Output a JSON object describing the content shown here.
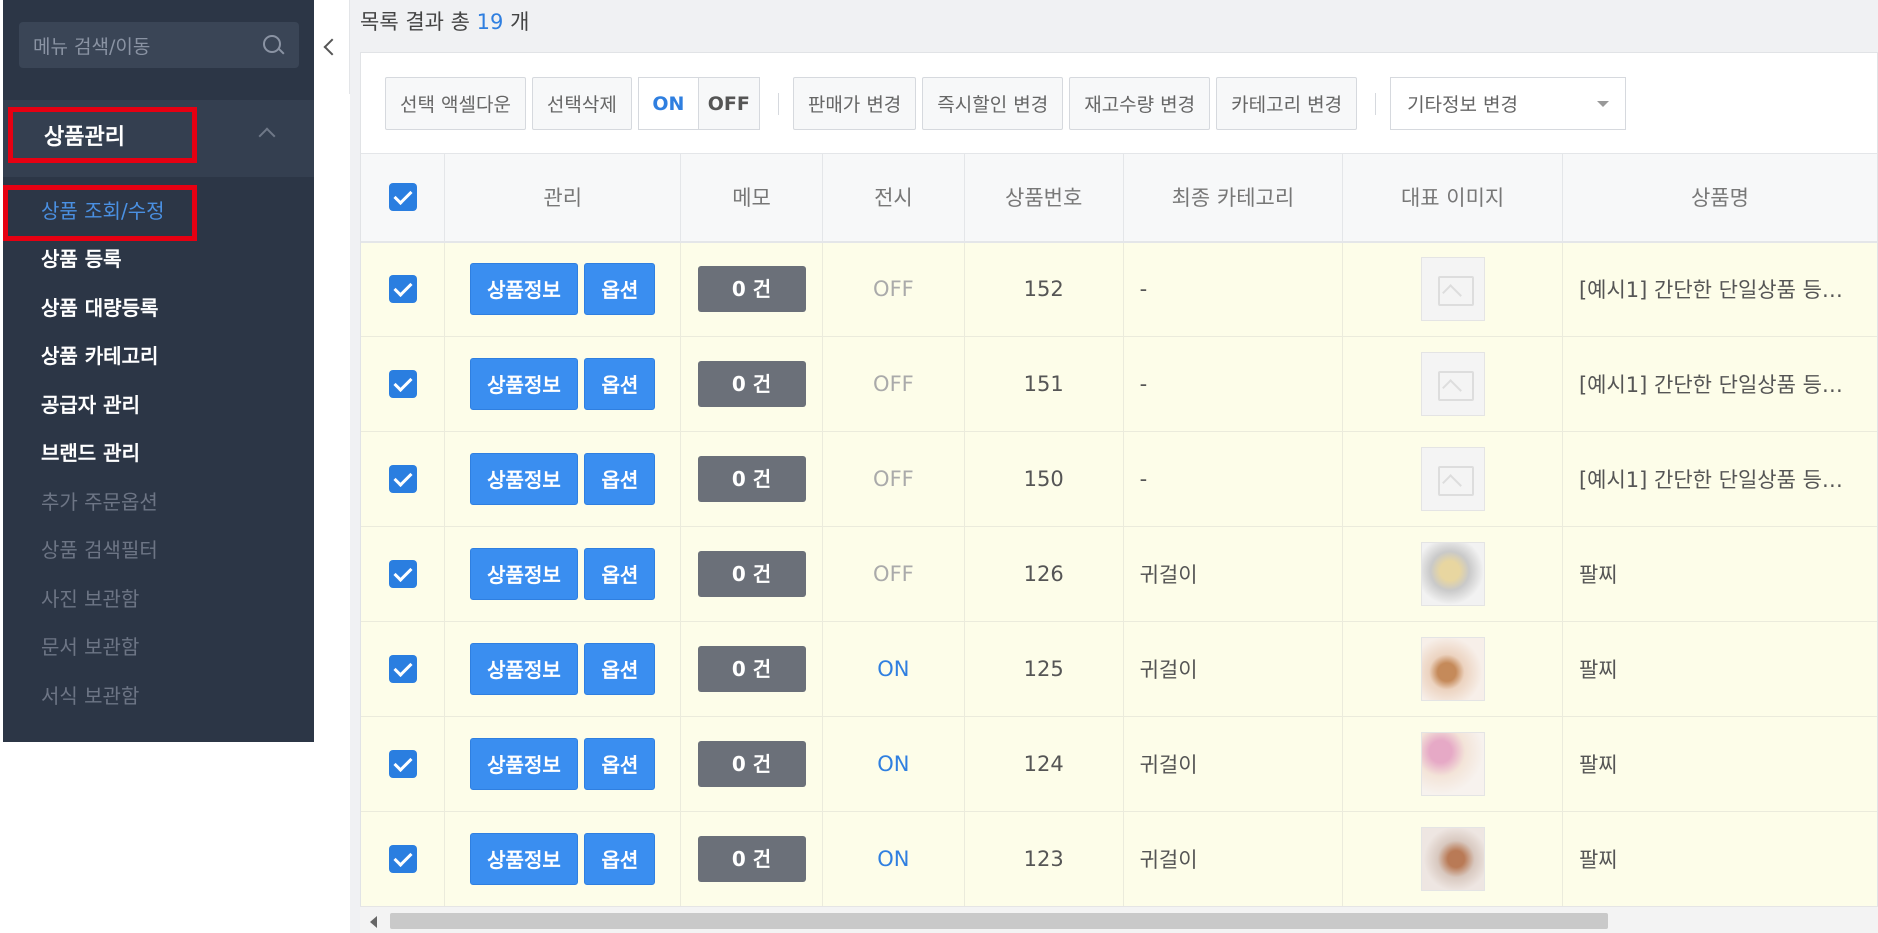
{
  "sidebar": {
    "search_placeholder": "메뉴 검색/이동",
    "section_title": "상품관리",
    "items": [
      {
        "label": "상품 조회/수정",
        "state": "active"
      },
      {
        "label": "상품 등록",
        "state": "normal"
      },
      {
        "label": "상품 대량등록",
        "state": "normal"
      },
      {
        "label": "상품 카테고리",
        "state": "normal"
      },
      {
        "label": "공급자 관리",
        "state": "normal"
      },
      {
        "label": "브랜드 관리",
        "state": "normal"
      },
      {
        "label": "추가 주문옵션",
        "state": "dim"
      },
      {
        "label": "상품 검색필터",
        "state": "dim"
      },
      {
        "label": "사진 보관함",
        "state": "dim"
      },
      {
        "label": "문서 보관함",
        "state": "dim"
      },
      {
        "label": "서식 보관함",
        "state": "dim"
      }
    ]
  },
  "result": {
    "prefix": "목록 결과 총",
    "count": "19",
    "suffix": "개"
  },
  "toolbar": {
    "excel": "선택 액셀다운",
    "delete": "선택삭제",
    "on": "ON",
    "off": "OFF",
    "price": "판매가 변경",
    "discount": "즉시할인 변경",
    "stock": "재고수량 변경",
    "category": "카테고리 변경",
    "other": "기타정보 변경"
  },
  "table": {
    "headers": {
      "manage": "관리",
      "memo": "메모",
      "display": "전시",
      "number": "상품번호",
      "category": "최종 카테고리",
      "image": "대표 이미지",
      "name": "상품명"
    },
    "button_info": "상품정보",
    "button_option": "옵션",
    "rows": [
      {
        "memo": "0 건",
        "display": "OFF",
        "number": "152",
        "category": "-",
        "image": "placeholder",
        "name": "[예시1] 간단한 단일상품 등…"
      },
      {
        "memo": "0 건",
        "display": "OFF",
        "number": "151",
        "category": "-",
        "image": "placeholder",
        "name": "[예시1] 간단한 단일상품 등…"
      },
      {
        "memo": "0 건",
        "display": "OFF",
        "number": "150",
        "category": "-",
        "image": "placeholder",
        "name": "[예시1] 간단한 단일상품 등…"
      },
      {
        "memo": "0 건",
        "display": "OFF",
        "number": "126",
        "category": "귀걸이",
        "image": "photo1",
        "name": "팔찌"
      },
      {
        "memo": "0 건",
        "display": "ON",
        "number": "125",
        "category": "귀걸이",
        "image": "photo2",
        "name": "팔찌"
      },
      {
        "memo": "0 건",
        "display": "ON",
        "number": "124",
        "category": "귀걸이",
        "image": "photo3",
        "name": "팔찌"
      },
      {
        "memo": "0 건",
        "display": "ON",
        "number": "123",
        "category": "귀걸이",
        "image": "photo4",
        "name": "팔찌"
      }
    ]
  }
}
